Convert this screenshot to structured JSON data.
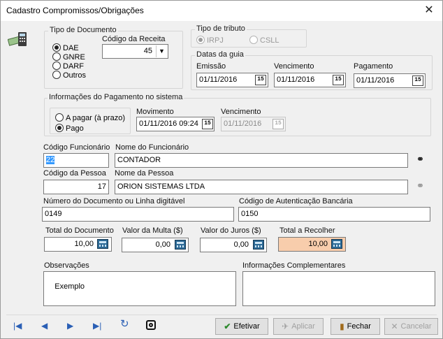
{
  "window": {
    "title": "Cadastro Compromissos/Obrigações"
  },
  "tipo_documento": {
    "label": "Tipo de Documento",
    "options": [
      {
        "label": "DAE",
        "checked": true
      },
      {
        "label": "GNRE",
        "checked": false
      },
      {
        "label": "DARF",
        "checked": false
      },
      {
        "label": "Outros",
        "checked": false
      }
    ]
  },
  "codigo_receita": {
    "label": "Código da Receita",
    "value": "45"
  },
  "tipo_tributo": {
    "label": "Tipo de tributo",
    "options": [
      {
        "label": "IRPJ",
        "checked": true
      },
      {
        "label": "CSLL",
        "checked": false
      }
    ]
  },
  "datas_guia": {
    "label": "Datas da guia",
    "emissao_label": "Emissão",
    "emissao": "01/11/2016",
    "vencimento_label": "Vencimento",
    "vencimento": "01/11/2016",
    "pagamento_label": "Pagamento",
    "pagamento": "01/11/2016"
  },
  "pagamento_sistema": {
    "label": "Informações do Pagamento no sistema",
    "options": [
      {
        "label": "A pagar (à prazo)",
        "checked": false
      },
      {
        "label": "Pago",
        "checked": true
      }
    ],
    "movimento_label": "Movimento",
    "movimento": "01/11/2016 09:24",
    "vencimento_label": "Vencimento",
    "vencimento": "01/11/2016"
  },
  "funcionario": {
    "codigo_label": "Código Funcionário",
    "codigo": "22",
    "nome_label": "Nome do Funcionário",
    "nome": "CONTADOR"
  },
  "pessoa": {
    "codigo_label": "Código da Pessoa",
    "codigo": "17",
    "nome_label": "Nome da Pessoa",
    "nome": "ORION SISTEMAS LTDA"
  },
  "documento": {
    "numero_label": "Número do Documento ou Linha digitável",
    "numero": "0149",
    "autenticacao_label": "Código de Autenticação Bancária",
    "autenticacao": "0150"
  },
  "valores": {
    "total_doc_label": "Total do Documento",
    "total_doc": "10,00",
    "multa_label": "Valor da Multa ($)",
    "multa": "0,00",
    "juros_label": "Valor do Juros ($)",
    "juros": "0,00",
    "total_recolher_label": "Total a Recolher",
    "total_recolher": "10,00"
  },
  "observacoes": {
    "label": "Observações",
    "value": "Exemplo"
  },
  "info_complementares": {
    "label": "Informações Complementares",
    "value": ""
  },
  "buttons": {
    "efetivar": "Efetivar",
    "aplicar": "Aplicar",
    "fechar": "Fechar",
    "cancelar": "Cancelar"
  },
  "colors": {
    "total_recolher_bg": "#f8cdac",
    "selection": "#3399ff"
  }
}
